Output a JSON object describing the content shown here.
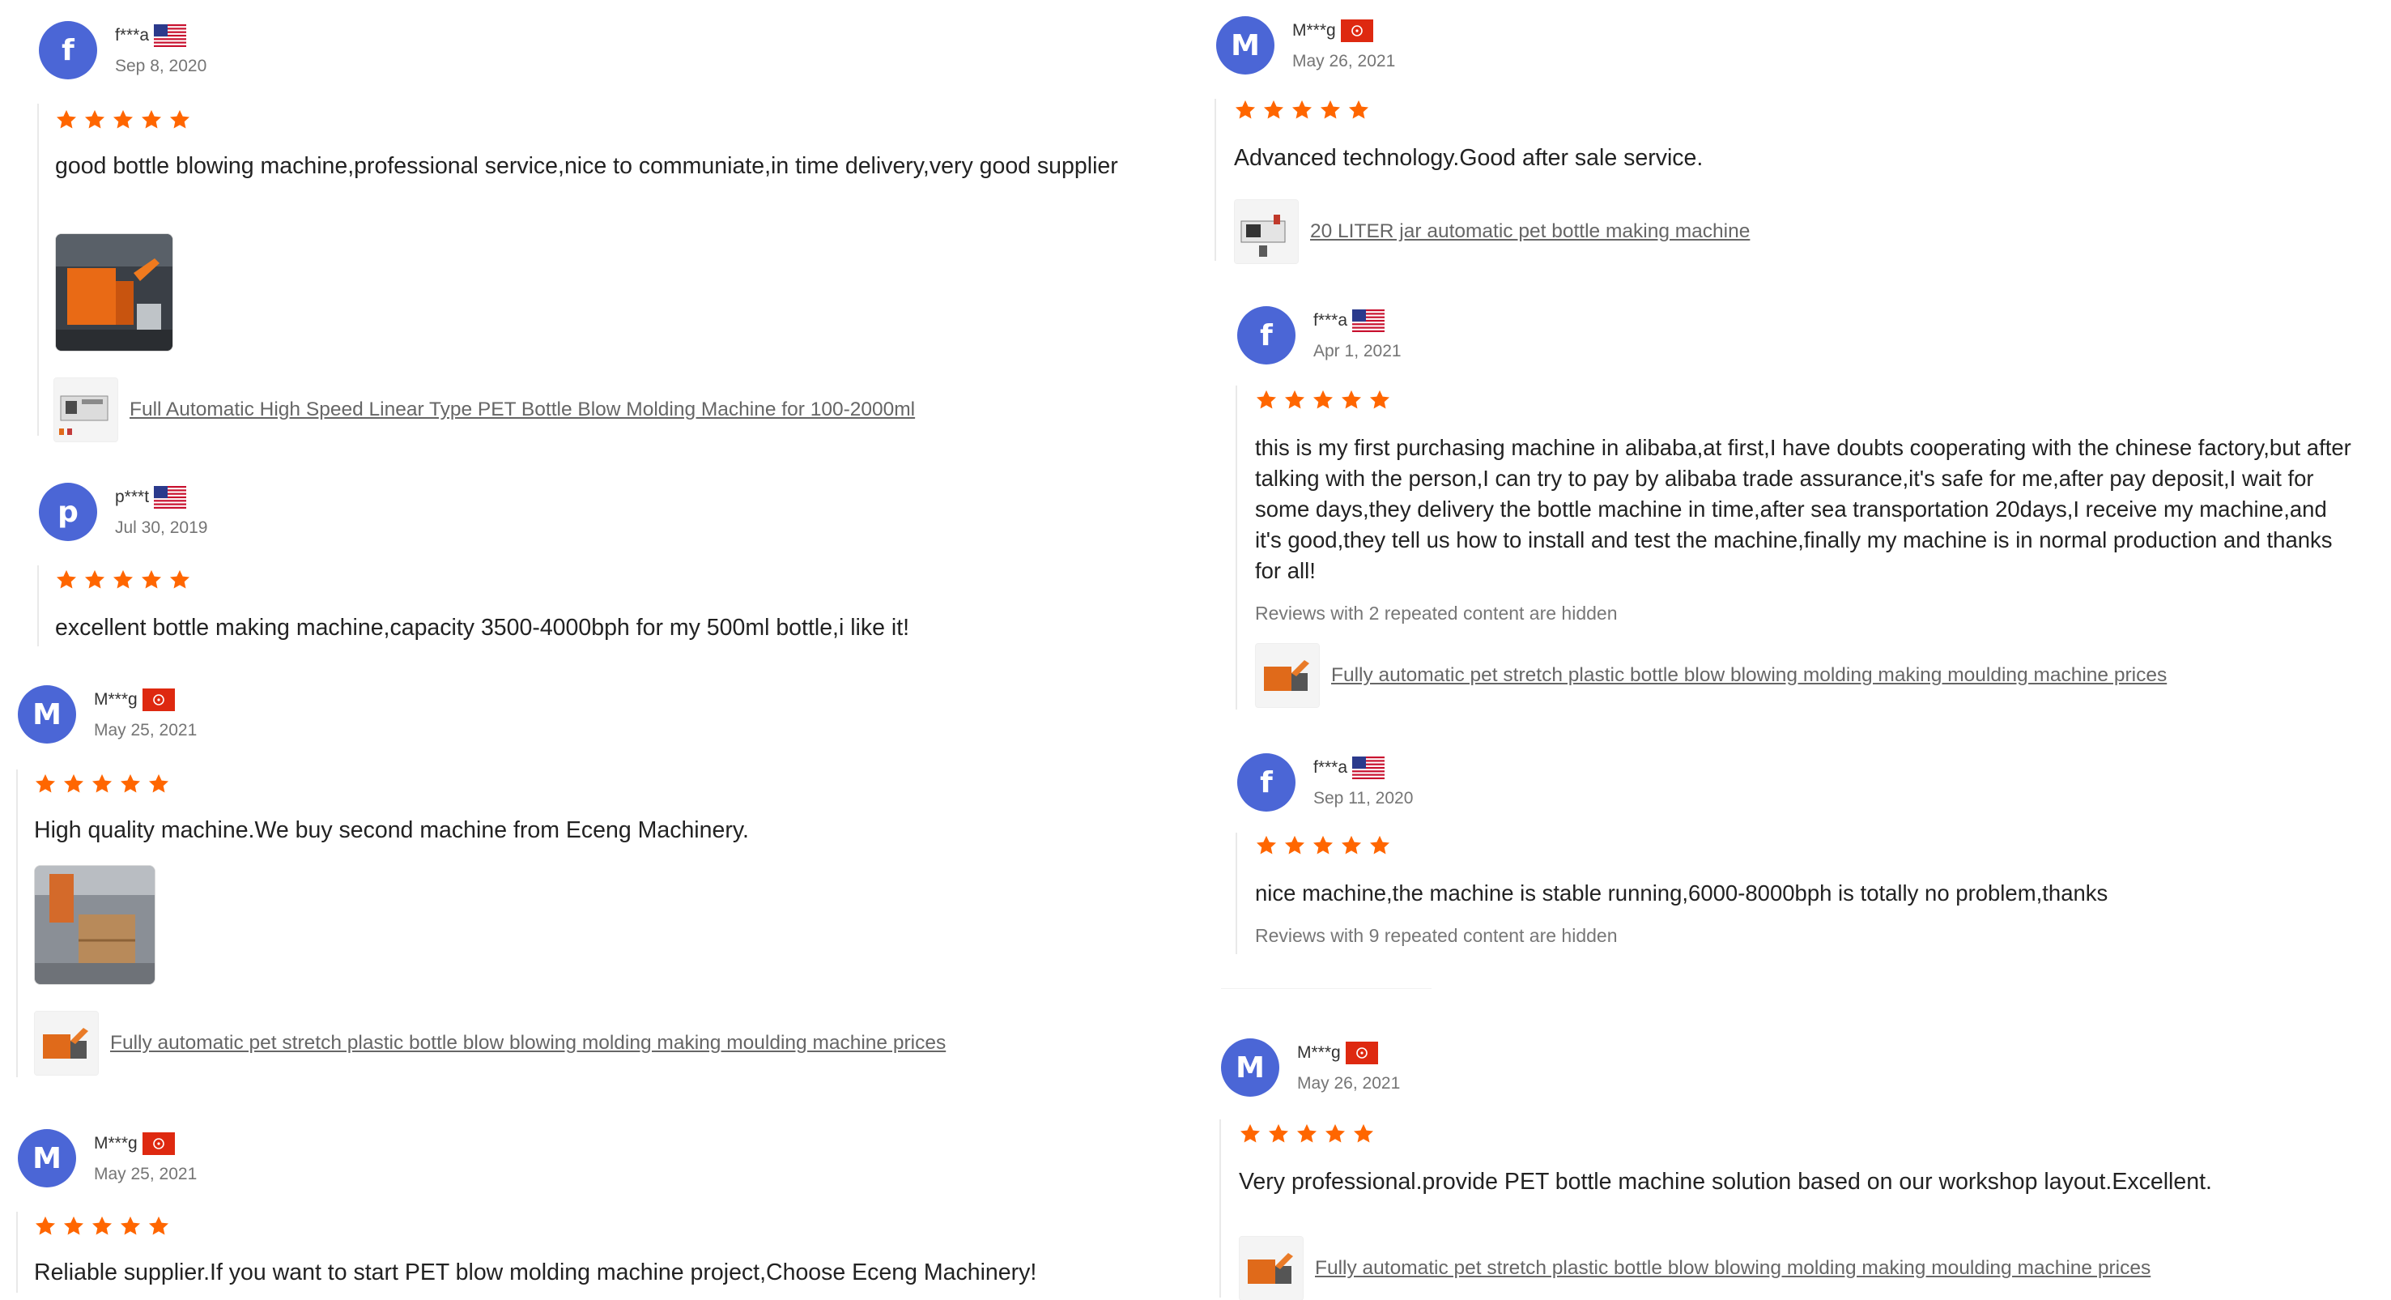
{
  "colors": {
    "avatar": "#4b66d6",
    "star": "#ff6600",
    "link": "#666666",
    "date": "#757575",
    "note": "#777777"
  },
  "icons": {
    "star": "star-icon",
    "flag_us": "us-flag-icon",
    "flag_hk": "hk-flag-icon"
  },
  "reviews": [
    {
      "avatar_letter": "f",
      "name": "f***a",
      "flag": "us",
      "date": "Sep 8, 2020",
      "rating": 5,
      "text": "good bottle blowing machine,professional service,nice to communiate,in time delivery,very good supplier",
      "product": "Full Automatic High Speed Linear Type PET Bottle Blow Molding Machine for 100-2000ml"
    },
    {
      "avatar_letter": "p",
      "name": "p***t",
      "flag": "us",
      "date": "Jul 30, 2019",
      "rating": 5,
      "text": "excellent bottle making machine,capacity 3500-4000bph for my 500ml bottle,i like it!"
    },
    {
      "avatar_letter": "M",
      "name": "M***g",
      "flag": "hk",
      "date": "May 25, 2021",
      "rating": 5,
      "text": "High quality machine.We buy second machine from Eceng Machinery.",
      "product": "Fully automatic pet stretch plastic bottle blow blowing molding making moulding machine prices"
    },
    {
      "avatar_letter": "M",
      "name": "M***g",
      "flag": "hk",
      "date": "May 25, 2021",
      "rating": 5,
      "text": "Reliable supplier.If you want to start PET blow molding machine project,Choose Eceng Machinery!"
    },
    {
      "avatar_letter": "M",
      "name": "M***g",
      "flag": "hk",
      "date": "May 26, 2021",
      "rating": 5,
      "text": "Advanced technology.Good after sale service.",
      "product": "20 LITER jar automatic pet bottle making machine"
    },
    {
      "avatar_letter": "f",
      "name": "f***a",
      "flag": "us",
      "date": "Apr 1, 2021",
      "rating": 5,
      "text": "this is my first purchasing machine in alibaba,at first,I have doubts cooperating with the chinese factory,but after talking with the person,I can try to pay by alibaba trade assurance,it's safe for me,after pay deposit,I wait for some days,they delivery the bottle machine in time,after sea transportation 20days,I receive my machine,and it's good,they tell us how to install and test the machine,finally my machine is in normal production and thanks for all!",
      "hidden_note": "Reviews with 2 repeated content are hidden",
      "product": "Fully automatic pet stretch plastic bottle blow blowing molding making moulding machine prices"
    },
    {
      "avatar_letter": "f",
      "name": "f***a",
      "flag": "us",
      "date": "Sep 11, 2020",
      "rating": 5,
      "text": "nice machine,the machine is stable running,6000-8000bph is totally no problem,thanks",
      "hidden_note": "Reviews with 9 repeated content are hidden"
    },
    {
      "avatar_letter": "M",
      "name": "M***g",
      "flag": "hk",
      "date": "May 26, 2021",
      "rating": 5,
      "text": "Very professional.provide PET bottle machine solution based on our workshop layout.Excellent.",
      "product": "Fully automatic pet stretch plastic bottle blow blowing molding making moulding machine prices"
    }
  ]
}
